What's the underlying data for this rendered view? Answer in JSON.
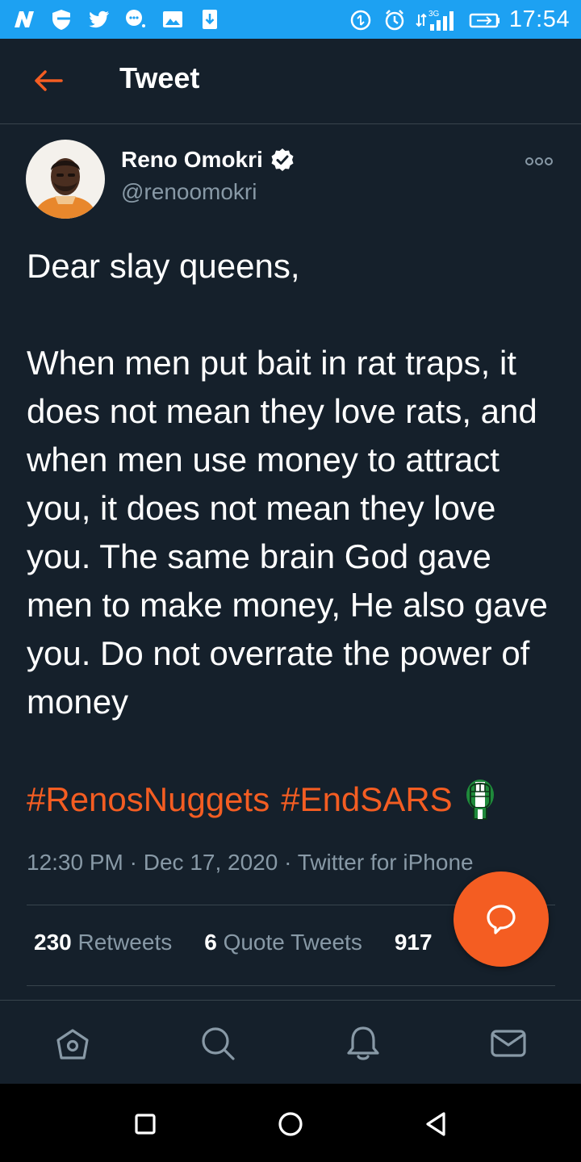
{
  "status_bar": {
    "time": "17:54",
    "network": "3G",
    "left_icons": [
      "n-app-icon",
      "shield-icon",
      "twitter-bird-icon",
      "chat-dots-icon",
      "image-icon",
      "download-icon"
    ],
    "right_icons": [
      "data-saver-icon",
      "alarm-icon",
      "signal-icon",
      "battery-icon"
    ],
    "color": "#1da1f2"
  },
  "header": {
    "title": "Tweet",
    "back_icon": "arrow-left-icon"
  },
  "tweet": {
    "author": {
      "name": "Reno Omokri",
      "handle": "@renoomokri",
      "verified": true
    },
    "text": "Dear slay queens,\n\nWhen men put bait in rat traps, it does not mean they love rats, and when men use money to attract you, it does not mean they love you. The same brain God gave men to make money, He also gave you. Do not overrate the power of money",
    "hashtags": [
      "#RenosNuggets",
      "#EndSARS"
    ],
    "meta": {
      "time": "12:30 PM",
      "separator": "·",
      "date": "Dec 17, 2020",
      "source": "Twitter for iPhone"
    },
    "stats": {
      "retweets_count": "230",
      "retweets_label": "Retweets",
      "quotes_count": "6",
      "quotes_label": "Quote Tweets",
      "likes_count": "917"
    }
  },
  "colors": {
    "background": "#15202b",
    "accent": "#f45d22",
    "muted": "#8899a6",
    "divider": "#38444d"
  },
  "bottom_nav": [
    "home-icon",
    "search-icon",
    "notifications-icon",
    "messages-icon"
  ],
  "system_nav": [
    "recents-icon",
    "home-circle-icon",
    "back-triangle-icon"
  ]
}
